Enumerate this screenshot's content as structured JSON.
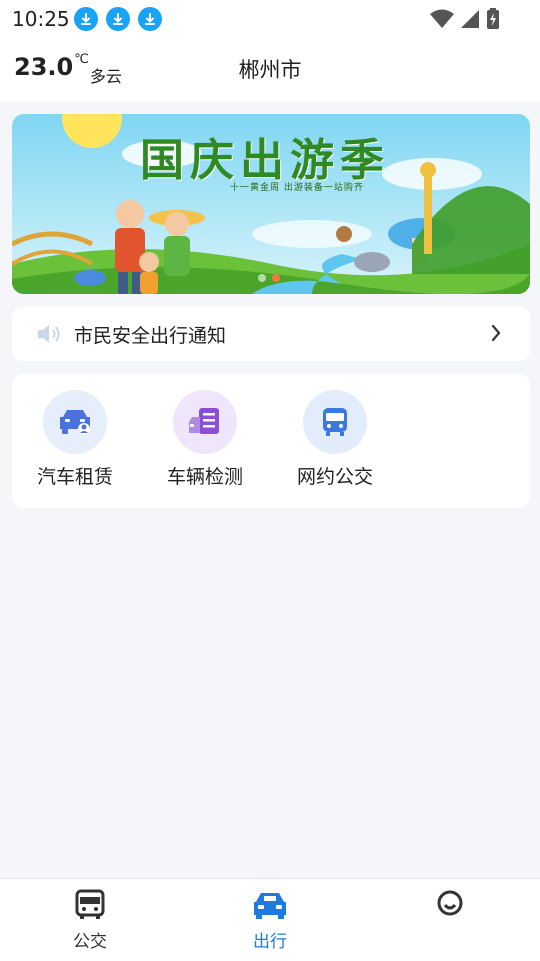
{
  "status_bar": {
    "time": "10:25",
    "icons": [
      "download-icon",
      "download-icon",
      "download-icon",
      "wifi-icon",
      "signal-icon",
      "battery-icon"
    ]
  },
  "header": {
    "temperature": "23.0",
    "unit": "℃",
    "weather": "多云",
    "city": "郴州市"
  },
  "banner": {
    "title": "国庆出游季",
    "subtitle": "十一黄金周 出游装备一站购齐"
  },
  "notice": {
    "text": "市民安全出行通知"
  },
  "services": [
    {
      "label": "汽车租赁",
      "icon": "car-rental-icon",
      "color": "#4a73d9",
      "bg": "#e6edfb"
    },
    {
      "label": "车辆检测",
      "icon": "vehicle-inspection-icon",
      "color": "#8a4fd6",
      "bg": "#efe6fb"
    },
    {
      "label": "网约公交",
      "icon": "bus-icon",
      "color": "#3a78e0",
      "bg": "#e3ecfa"
    }
  ],
  "tabs": [
    {
      "label": "公交",
      "icon": "bus-icon",
      "active": false
    },
    {
      "label": "出行",
      "icon": "car-icon",
      "active": true
    },
    {
      "label": "",
      "icon": "profile-icon",
      "active": false
    }
  ],
  "colors": {
    "accent": "#1f7ae0",
    "tab_inactive": "#333333"
  }
}
